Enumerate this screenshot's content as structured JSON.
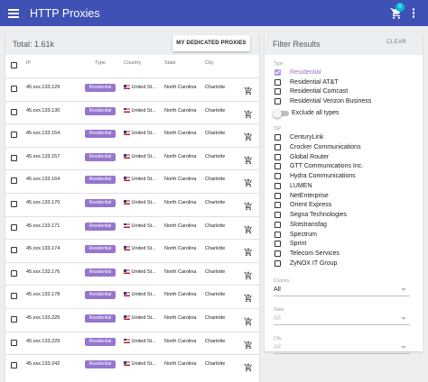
{
  "appbar": {
    "title": "HTTP Proxies",
    "cart_count": "0"
  },
  "left": {
    "total": "Total: 1.61k",
    "dedicated_button": "MY DEDICATED PROXIES",
    "columns": {
      "ip": "IP",
      "type": "Type",
      "country": "Country",
      "state": "State",
      "city": "City"
    },
    "rows": [
      {
        "ip": "45.xxx.133.129",
        "type": "Residential",
        "country": "United St...",
        "state": "North Carolina",
        "city": "Charlotte"
      },
      {
        "ip": "45.xxx.133.130",
        "type": "Residential",
        "country": "United St...",
        "state": "North Carolina",
        "city": "Charlotte"
      },
      {
        "ip": "45.xxx.133.154",
        "type": "Residential",
        "country": "United St...",
        "state": "North Carolina",
        "city": "Charlotte"
      },
      {
        "ip": "45.xxx.133.157",
        "type": "Residential",
        "country": "United St...",
        "state": "North Carolina",
        "city": "Charlotte"
      },
      {
        "ip": "45.xxx.133.164",
        "type": "Residential",
        "country": "United St...",
        "state": "North Carolina",
        "city": "Charlotte"
      },
      {
        "ip": "45.xxx.133.170",
        "type": "Residential",
        "country": "United St...",
        "state": "North Carolina",
        "city": "Charlotte"
      },
      {
        "ip": "45.xxx.133.171",
        "type": "Residential",
        "country": "United St...",
        "state": "North Carolina",
        "city": "Charlotte"
      },
      {
        "ip": "45.xxx.133.174",
        "type": "Residential",
        "country": "United St...",
        "state": "North Carolina",
        "city": "Charlotte"
      },
      {
        "ip": "45.xxx.133.176",
        "type": "Residential",
        "country": "United St...",
        "state": "North Carolina",
        "city": "Charlotte"
      },
      {
        "ip": "45.xxx.133.178",
        "type": "Residential",
        "country": "United St...",
        "state": "North Carolina",
        "city": "Charlotte"
      },
      {
        "ip": "45.xxx.133.225",
        "type": "Residential",
        "country": "United St...",
        "state": "North Carolina",
        "city": "Charlotte"
      },
      {
        "ip": "45.xxx.133.229",
        "type": "Residential",
        "country": "United St...",
        "state": "North Carolina",
        "city": "Charlotte"
      },
      {
        "ip": "45.xxx.133.242",
        "type": "Residential",
        "country": "United St...",
        "state": "North Carolina",
        "city": "Charlotte"
      }
    ]
  },
  "filter": {
    "title": "Filter Results",
    "clear": "CLEAR",
    "type_label": "Type",
    "types": [
      {
        "label": "Residential",
        "checked": true
      },
      {
        "label": "Residential AT&T",
        "checked": false
      },
      {
        "label": "Residential Comcast",
        "checked": false
      },
      {
        "label": "Residential Verizon Business",
        "checked": false
      }
    ],
    "exclude_label": "Exclude all types",
    "isp_label": "ISP",
    "isps": [
      "CenturyLink",
      "Crocker Communications",
      "Global Router",
      "GTT Communications Inc.",
      "Hydra Communications",
      "LUMEN",
      "NetEnterprise",
      "Orient Express",
      "Segna Technologies",
      "Slotstransfag",
      "Spectrum",
      "Sprint",
      "Telecom Services",
      "ZyNOX IT Group"
    ],
    "country_label": "Country",
    "country_value": "All",
    "state_label": "State",
    "state_value": "All",
    "city_label": "City",
    "city_value": "All"
  },
  "colors": {
    "appbar": "#3f51b5",
    "badge": "#9575cd",
    "cart_badge": "#00bcd4"
  },
  "icons": {
    "menu": "menu-icon",
    "cart": "cart-icon",
    "more": "more-vert-icon",
    "add_cart": "add-shopping-cart-icon",
    "flag": "us-flag-icon"
  }
}
